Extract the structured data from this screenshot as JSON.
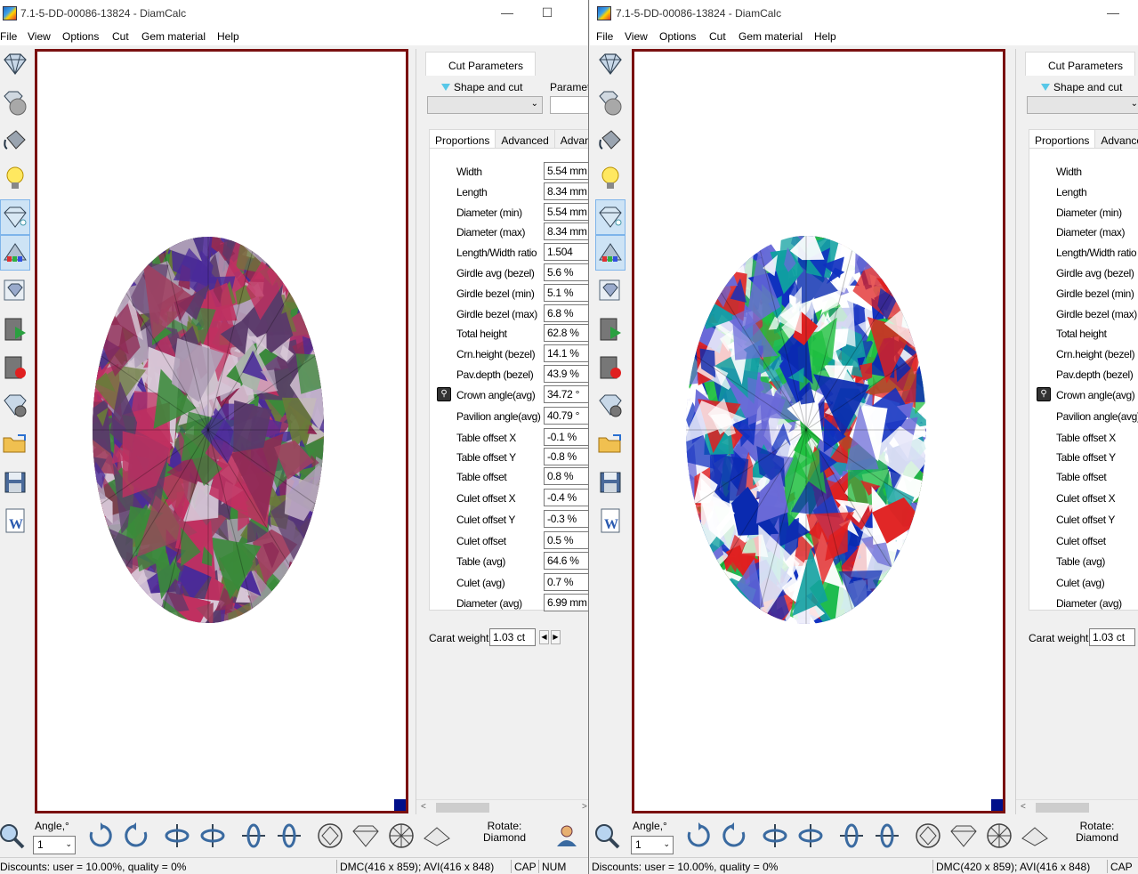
{
  "windows": [
    {
      "title": "7.1-5-DD-00086-13824 - DiamCalc",
      "menu": [
        "File",
        "View",
        "Options",
        "Cut",
        "Gem material",
        "Help"
      ],
      "panel": {
        "top_tab": "Cut Parameters",
        "shape_label": "Shape and cut",
        "params_label": "Paramete",
        "subtabs": [
          "Proportions",
          "Advanced",
          "Advanced"
        ],
        "props": [
          {
            "label": "Width",
            "value": "5.54 mm"
          },
          {
            "label": "Length",
            "value": "8.34 mm"
          },
          {
            "label": "Diameter (min)",
            "value": "5.54 mm"
          },
          {
            "label": "Diameter (max)",
            "value": "8.34 mm"
          },
          {
            "label": "Length/Width ratio",
            "value": "1.504"
          },
          {
            "label": "Girdle avg (bezel)",
            "value": "5.6 %"
          },
          {
            "label": "Girdle bezel (min)",
            "value": "5.1 %"
          },
          {
            "label": "Girdle bezel (max)",
            "value": "6.8 %"
          },
          {
            "label": "Total height",
            "value": "62.8 %"
          },
          {
            "label": "Crn.height (bezel)",
            "value": "14.1 %"
          },
          {
            "label": "Pav.depth (bezel)",
            "value": "43.9 %"
          },
          {
            "label": "Crown angle(avg)",
            "value": "34.72 °"
          },
          {
            "label": "Pavilion angle(avg)",
            "value": "40.79 °"
          },
          {
            "label": "Table offset X",
            "value": "-0.1 %"
          },
          {
            "label": "Table offset Y",
            "value": "-0.8 %"
          },
          {
            "label": "Table offset",
            "value": "0.8 %"
          },
          {
            "label": "Culet offset X",
            "value": "-0.4 %"
          },
          {
            "label": "Culet offset Y",
            "value": "-0.3 %"
          },
          {
            "label": "Culet offset",
            "value": "0.5 %"
          },
          {
            "label": "Table (avg)",
            "value": "64.6 %"
          },
          {
            "label": "Culet (avg)",
            "value": "0.7 %"
          },
          {
            "label": "Diameter (avg)",
            "value": "6.99 mm"
          }
        ],
        "carat_label": "Carat weight",
        "carat_value": "1.03 ct"
      },
      "bottom": {
        "angle_label": "Angle,°",
        "angle_value": "1",
        "rotate_label": "Rotate:",
        "rotate_value": "Diamond"
      },
      "status": {
        "discounts": "Discounts: user = 10.00%, quality = 0%",
        "dmc": "DMC(416 x 859); AVI(416 x 848)",
        "cap": "CAP",
        "num": "NUM"
      }
    },
    {
      "title": "7.1-5-DD-00086-13824 - DiamCalc",
      "menu": [
        "File",
        "View",
        "Options",
        "Cut",
        "Gem material",
        "Help"
      ],
      "panel": {
        "top_tab": "Cut Parameters",
        "shape_label": "Shape and cut",
        "subtabs": [
          "Proportions",
          "Advanced"
        ],
        "props": [
          {
            "label": "Width"
          },
          {
            "label": "Length"
          },
          {
            "label": "Diameter (min)"
          },
          {
            "label": "Diameter (max)"
          },
          {
            "label": "Length/Width ratio"
          },
          {
            "label": "Girdle avg (bezel)"
          },
          {
            "label": "Girdle bezel (min)"
          },
          {
            "label": "Girdle bezel (max)"
          },
          {
            "label": "Total height"
          },
          {
            "label": "Crn.height (bezel)"
          },
          {
            "label": "Pav.depth (bezel)"
          },
          {
            "label": "Crown angle(avg)"
          },
          {
            "label": "Pavilion angle(avg)"
          },
          {
            "label": "Table offset X"
          },
          {
            "label": "Table offset Y"
          },
          {
            "label": "Table offset"
          },
          {
            "label": "Culet offset X"
          },
          {
            "label": "Culet offset Y"
          },
          {
            "label": "Culet offset"
          },
          {
            "label": "Table (avg)"
          },
          {
            "label": "Culet (avg)"
          },
          {
            "label": "Diameter (avg)"
          }
        ],
        "carat_label": "Carat weight",
        "carat_value": "1.03 ct"
      },
      "bottom": {
        "angle_label": "Angle,°",
        "angle_value": "1",
        "rotate_label": "Rotate:",
        "rotate_value": "Diamond"
      },
      "status": {
        "discounts": "Discounts: user = 10.00%, quality = 0%",
        "dmc": "DMC(420 x 859); AVI(416 x 848)",
        "cap": "CAP"
      }
    }
  ],
  "colors": {
    "view_border": "#7a1010",
    "gem_left_palette": [
      "#8e2a55",
      "#6a7a3a",
      "#4a2a9a",
      "#b0a0b8",
      "#3a8a3a",
      "#c03060"
    ],
    "gem_right_palette": [
      "#0a2ab0",
      "#10a0a0",
      "#e02020",
      "#20c040",
      "#ffffff",
      "#6a6ad8"
    ]
  },
  "icons": [
    "diamond-icon",
    "gem-ball-icon",
    "paint-bucket-icon",
    "light-bulb-icon",
    "diamond-sparkle-icon",
    "spectrum-icon",
    "diamond-screen-icon",
    "video-play-icon",
    "video-record-icon",
    "diamond-gear-icon",
    "open-folder-icon",
    "save-icon",
    "word-icon"
  ]
}
